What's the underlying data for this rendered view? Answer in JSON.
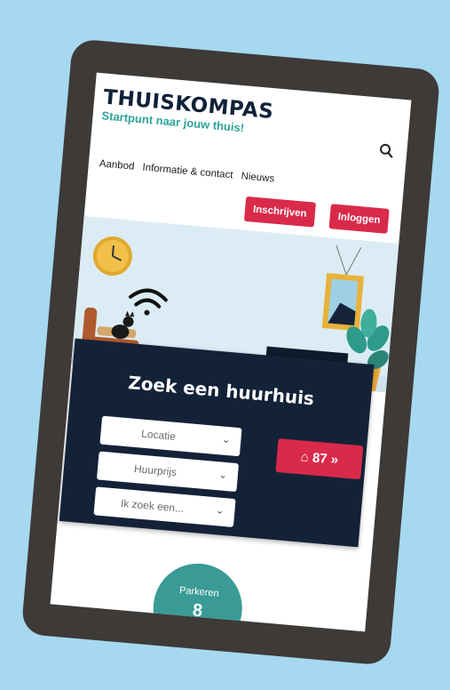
{
  "brand": {
    "name": "THUISKOMPAS",
    "tagline": "Startpunt naar jouw thuis!"
  },
  "nav": {
    "items": [
      "Aanbod",
      "Informatie & contact",
      "Nieuws"
    ]
  },
  "header": {
    "register_label": "Inschrijven",
    "login_label": "Inloggen"
  },
  "search": {
    "title": "Zoek een huurhuis",
    "fields": {
      "location": "Locatie",
      "price": "Huurprijs",
      "type": "Ik zoek een..."
    },
    "result_count": "87",
    "result_suffix": "»"
  },
  "stats": {
    "label": "Parkeren",
    "value": "8"
  },
  "icons": [
    "search-icon",
    "chevron-down-icon",
    "home-icon",
    "clock-icon",
    "wifi-icon",
    "plant-icon"
  ],
  "colors": {
    "accent": "#d92a4a",
    "navy": "#142238",
    "teal": "#2fa39b",
    "background": "#a6d8f0"
  }
}
